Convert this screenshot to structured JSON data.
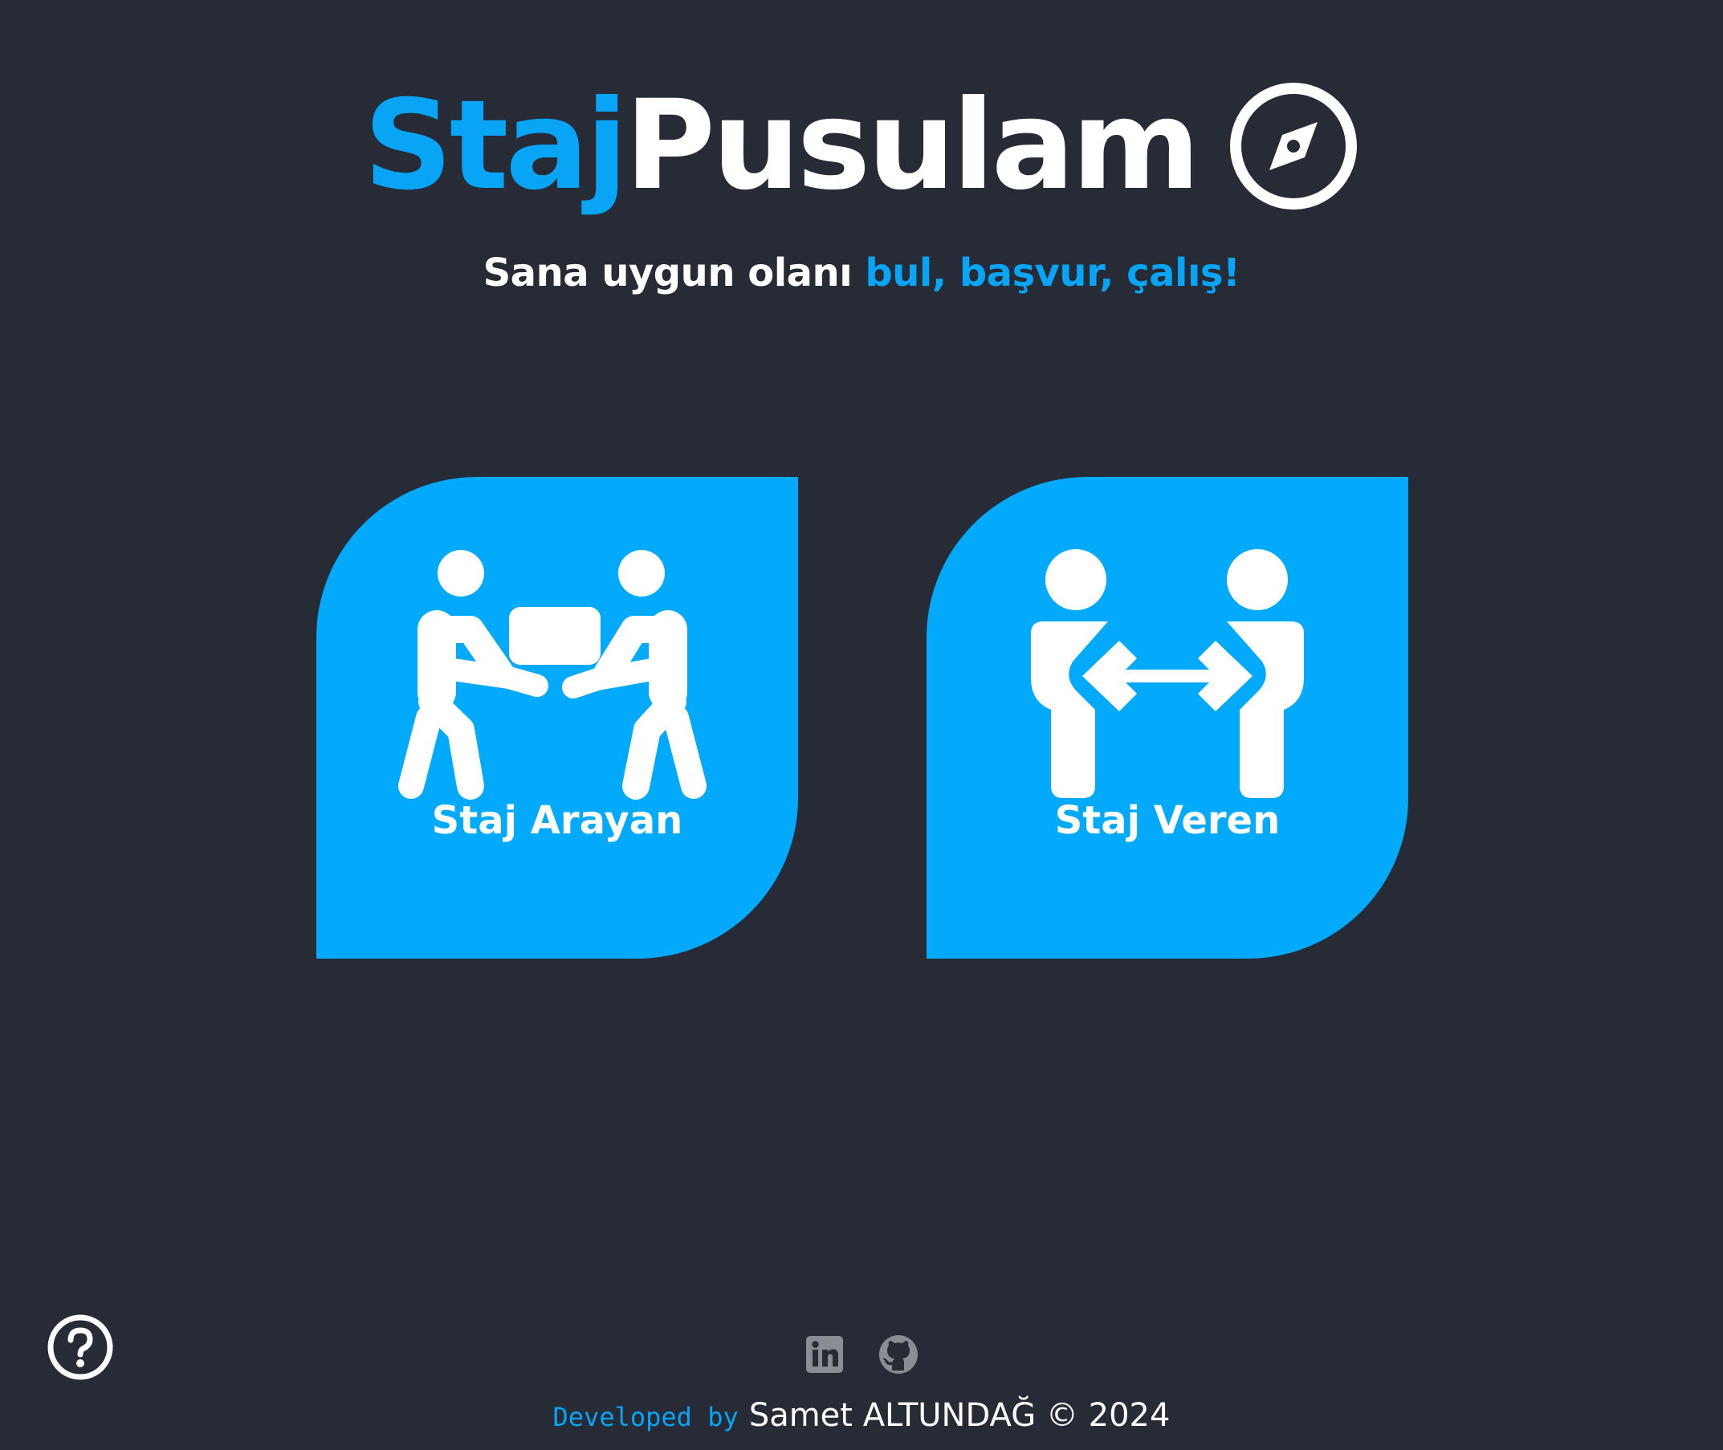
{
  "header": {
    "title_part1": "Staj",
    "title_part2": "Pusulam",
    "logo_icon": "compass-icon",
    "tagline_plain": "Sana uygun olanı",
    "tagline_accent": "bul, başvur, çalış!"
  },
  "cards": [
    {
      "label": "Staj Arayan",
      "icon": "people-carry-box-icon"
    },
    {
      "label": "Staj Veren",
      "icon": "people-arrows-icon"
    }
  ],
  "help": {
    "icon": "question-circle-icon"
  },
  "footer": {
    "social": [
      {
        "icon": "linkedin-icon"
      },
      {
        "icon": "github-icon"
      }
    ],
    "developed_by": "Developed by",
    "author": "Samet ALTUNDAĞ © 2024"
  },
  "colors": {
    "background": "#262b35",
    "accent": "#08a4f5",
    "card": "#03a9fa",
    "text": "#ffffff",
    "social_icon": "#8a8d92"
  }
}
